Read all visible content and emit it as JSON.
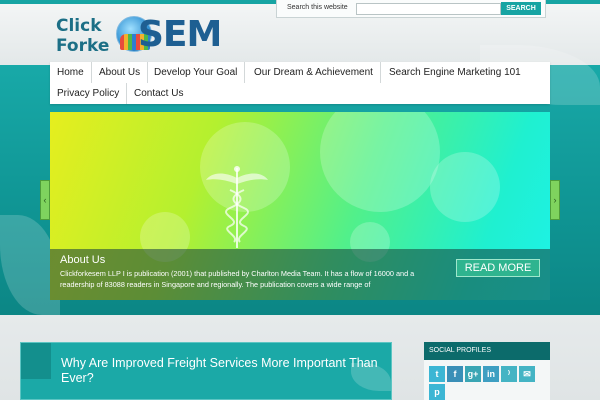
{
  "logo": {
    "click": "Click",
    "forke": "Forke",
    "sem": "SEM"
  },
  "search": {
    "label": "Search this website",
    "button": "SEARCH",
    "value": ""
  },
  "nav": {
    "items": [
      "Home",
      "About Us",
      "Develop Your Goal",
      "Our Dream & Achievement",
      "Search Engine Marketing 101",
      "Privacy Policy",
      "Contact Us"
    ]
  },
  "slider": {
    "title": "About Us",
    "text": "Clickforkesem LLP I is publication (2001) that published by Charlton Media Team. It has a flow of 16000 and a readership of 83088 readers in Singapore and regionally. The publication covers a wide range of",
    "read_more": "READ MORE",
    "prev_glyph": "‹",
    "next_glyph": "›"
  },
  "post": {
    "title": "Why Are Improved Freight Services More Important Than Ever?"
  },
  "sidebar": {
    "social_title": "SOCIAL PROFILES",
    "icons": [
      "twitter-icon",
      "facebook-icon",
      "google-plus-icon",
      "linkedin-icon",
      "rss-icon",
      "email-icon",
      "pinterest-icon"
    ],
    "glyphs": [
      "t",
      "f",
      "g+",
      "in",
      "⁾",
      "✉",
      "p"
    ]
  },
  "colors": {
    "accent": "#17a4a3",
    "nav_bg": "#ffffff",
    "sidebar_head": "#0c6b6b"
  }
}
